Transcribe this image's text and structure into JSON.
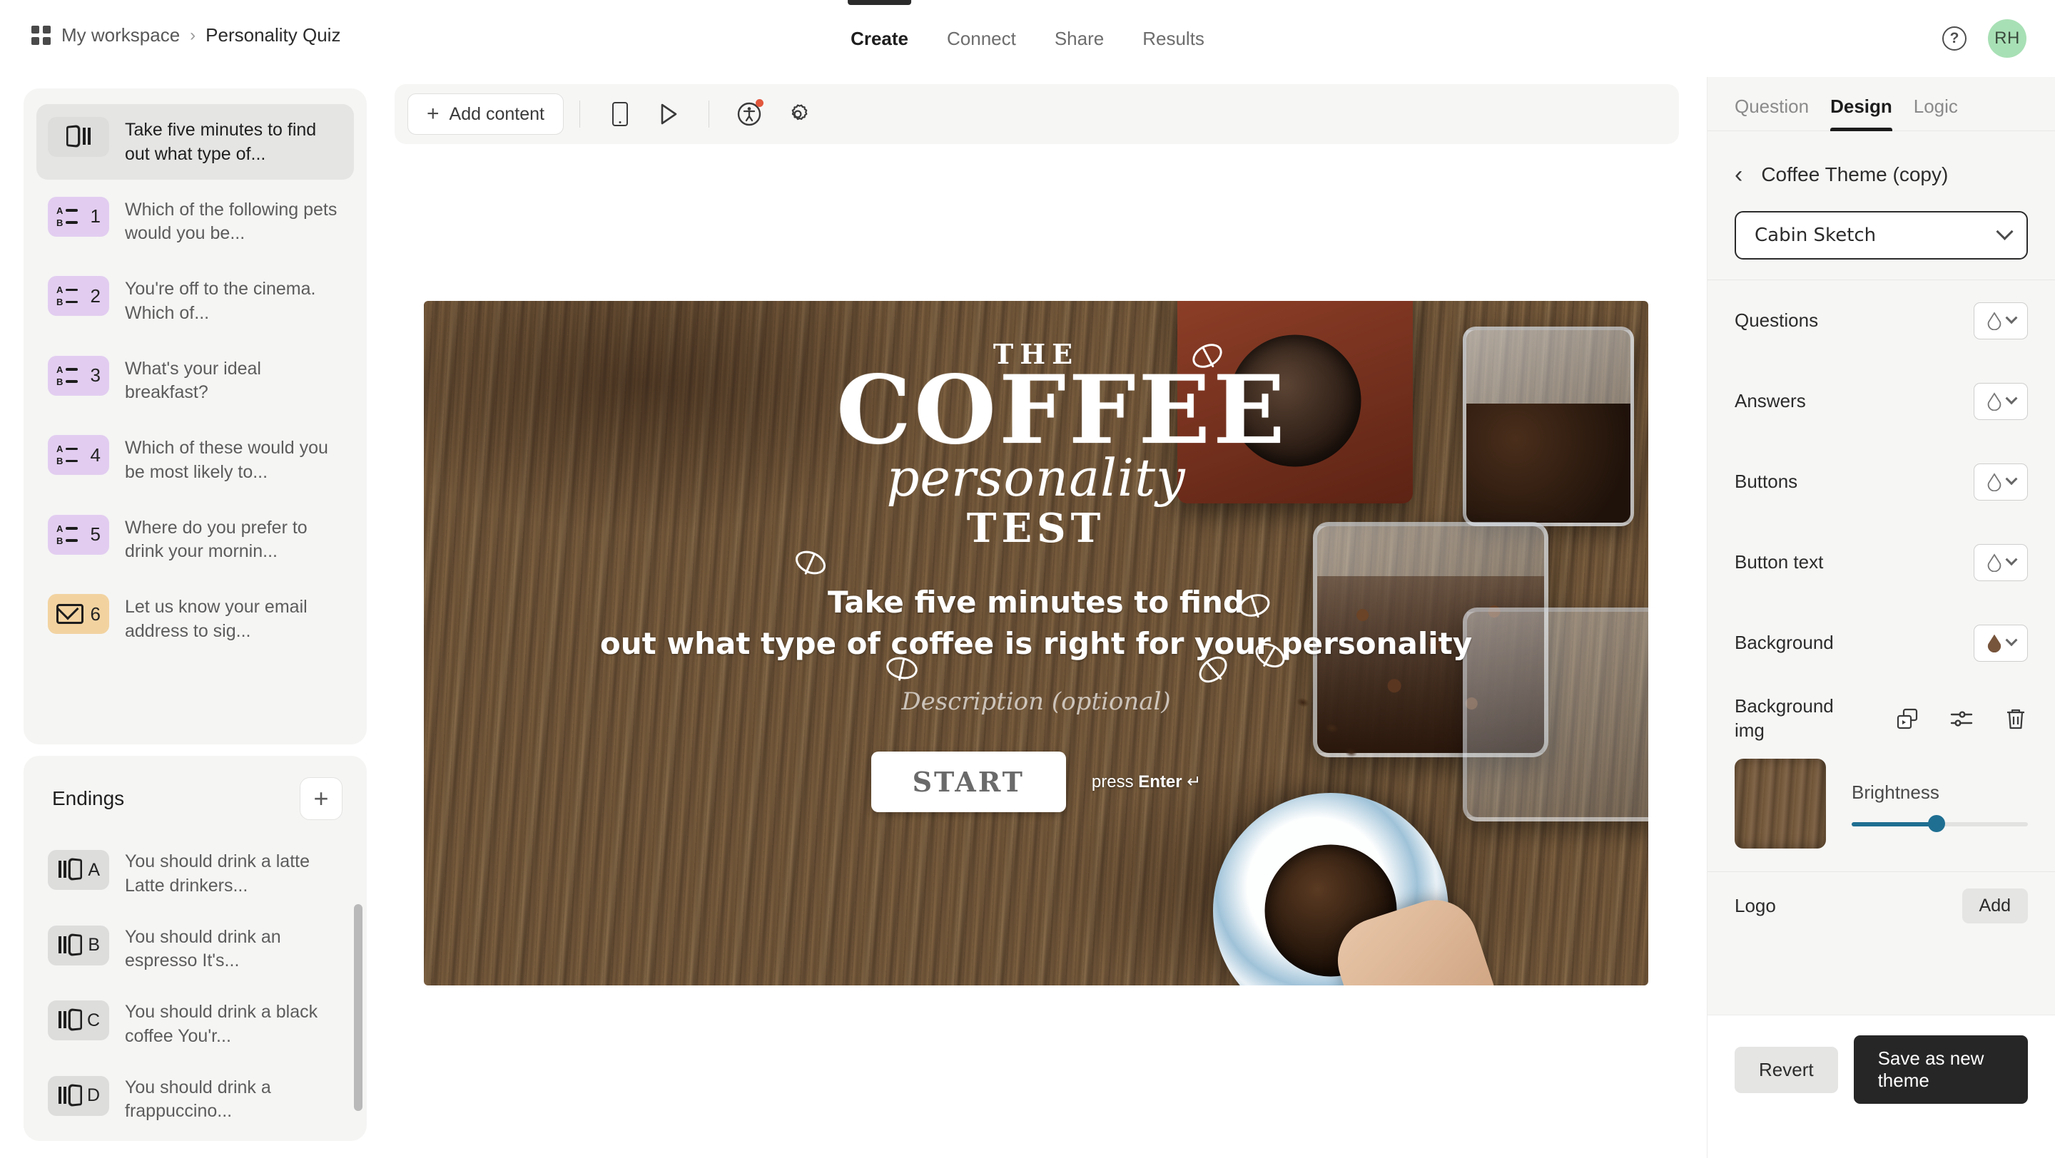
{
  "header": {
    "workspace": "My workspace",
    "separator": "›",
    "form_title": "Personality Quiz",
    "tabs": [
      {
        "label": "Create",
        "active": true
      },
      {
        "label": "Connect",
        "active": false
      },
      {
        "label": "Share",
        "active": false
      },
      {
        "label": "Results",
        "active": false
      }
    ],
    "help_icon": "?",
    "avatar_initials": "RH",
    "avatar_color": "#a8e0b5"
  },
  "toolbar": {
    "add_content_label": "Add content",
    "plus": "+",
    "icons": [
      "mobile-preview-icon",
      "play-preview-icon",
      "accessibility-icon",
      "settings-gear-icon"
    ],
    "accessibility_badge_color": "#e2583d"
  },
  "questions_panel": {
    "items": [
      {
        "badge": "welcome",
        "number": "",
        "text": "Take five minutes to find out what type of...",
        "selected": true
      },
      {
        "badge": "choice",
        "number": "1",
        "text": "Which of the following pets would you be...",
        "selected": false
      },
      {
        "badge": "choice",
        "number": "2",
        "text": "You're off to the cinema. Which of...",
        "selected": false
      },
      {
        "badge": "choice",
        "number": "3",
        "text": "What's your ideal breakfast?",
        "selected": false
      },
      {
        "badge": "choice",
        "number": "4",
        "text": "Which of these would you be most likely to...",
        "selected": false
      },
      {
        "badge": "choice",
        "number": "5",
        "text": "Where do you prefer to drink your mornin...",
        "selected": false
      },
      {
        "badge": "email",
        "number": "6",
        "text": "Let us know your email address to sig...",
        "selected": false
      }
    ]
  },
  "endings_panel": {
    "title": "Endings",
    "add_label": "+",
    "items": [
      {
        "letter": "A",
        "text": "You should drink a latte Latte drinkers..."
      },
      {
        "letter": "B",
        "text": "You should drink an espresso It's..."
      },
      {
        "letter": "C",
        "text": "You should drink a black coffee You'r..."
      },
      {
        "letter": "D",
        "text": "You should drink a frappuccino..."
      }
    ]
  },
  "canvas": {
    "logo_the": "THE",
    "logo_coffee": "COFFEE",
    "logo_personality": "personality",
    "logo_test": "TEST",
    "headline_line1": "Take five minutes to find",
    "headline_line2": "out what type of coffee is right for your personality",
    "description_placeholder": "Description (optional)",
    "start_button": "START",
    "press_enter_prefix": "press ",
    "press_enter_key": "Enter",
    "press_enter_arrow": "↵"
  },
  "design_panel": {
    "tabs": [
      {
        "label": "Question",
        "active": false
      },
      {
        "label": "Design",
        "active": true
      },
      {
        "label": "Logic",
        "active": false
      }
    ],
    "back_chevron": "‹",
    "theme_name": "Coffee Theme (copy)",
    "font_value": "Cabin Sketch",
    "color_rows": [
      {
        "label": "Questions",
        "color": "none"
      },
      {
        "label": "Answers",
        "color": "none"
      },
      {
        "label": "Buttons",
        "color": "none"
      },
      {
        "label": "Button text",
        "color": "none"
      },
      {
        "label": "Background",
        "color": "#77553c"
      }
    ],
    "background_img_label": "Background img",
    "background_img_icons": [
      "replace-image-icon",
      "adjust-sliders-icon",
      "delete-trash-icon"
    ],
    "brightness_label": "Brightness",
    "brightness_value": 48,
    "logo_label": "Logo",
    "logo_add_label": "Add",
    "revert_label": "Revert",
    "save_label": "Save as new theme",
    "accent_color": "#1f6f92"
  }
}
